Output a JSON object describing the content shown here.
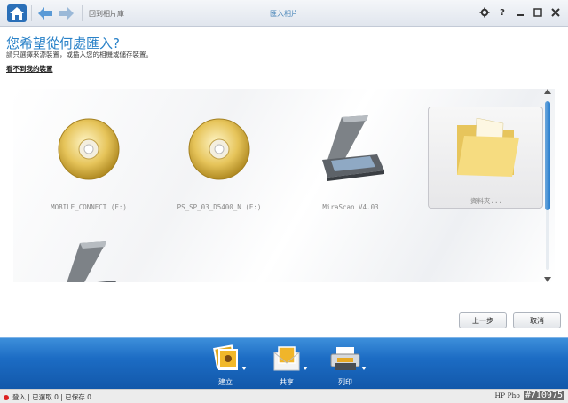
{
  "titlebar": {
    "back_link": "回到相片庫",
    "window_title": "匯入相片",
    "icons": [
      "home-icon",
      "back-arrow-icon",
      "forward-arrow-icon",
      "settings-icon",
      "help-icon",
      "minimize-icon",
      "maximize-icon",
      "close-icon"
    ],
    "help_label": "?"
  },
  "header": {
    "heading": "您希望從何處匯入?",
    "subtext": "請只選擇來源裝置，或插入您的相機或儲存裝置。",
    "cant_find": "看不到我的裝置"
  },
  "devices": [
    {
      "label": "MOBILE_CONNECT (F:)",
      "icon": "cd-disc-icon"
    },
    {
      "label": "PS_SP_03_D5400_N (E:)",
      "icon": "cd-disc-icon"
    },
    {
      "label": "MiraScan V4.03",
      "icon": "scanner-icon"
    },
    {
      "label": "資料夾...",
      "icon": "folder-icon",
      "selected": true
    },
    {
      "label": "",
      "icon": "scanner-icon"
    }
  ],
  "buttons": {
    "back": "上一步",
    "cancel": "取消"
  },
  "taskbar": [
    {
      "label": "建立",
      "icon": "create-photos-icon"
    },
    {
      "label": "共享",
      "icon": "share-envelope-icon"
    },
    {
      "label": "列印",
      "icon": "printer-icon"
    }
  ],
  "status": {
    "text": "登入 | 已選取 0 | 已保存 0",
    "brand": "HP Pho",
    "watermark": "#710975"
  },
  "colors": {
    "accent": "#2a82c8",
    "taskbar": "#1c6cc4"
  }
}
